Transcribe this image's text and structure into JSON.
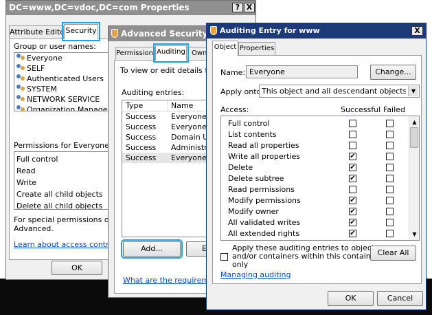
{
  "main_dialog": {
    "title": "DC=www,DC=vdoc,DC=com Properties",
    "help_button": "?",
    "close_button": "X",
    "tabs": [
      "Attribute Editor",
      "Security"
    ],
    "group_label": "Group or user names:",
    "users": [
      "Everyone",
      "SELF",
      "Authenticated Users",
      "SYSTEM",
      "NETWORK SERVICE",
      "Organization Manageme"
    ],
    "permissions_label": "Permissions for Everyone",
    "permissions": [
      "Full control",
      "Read",
      "Write",
      "Create all child objects",
      "Delete all child objects"
    ],
    "special_text": "For special permissions or ad\nAdvanced.",
    "learn_link": "Learn about access control a",
    "ok_label": "OK"
  },
  "advanced_dialog": {
    "title": "Advanced Security Setti",
    "tabs": [
      "Permissions",
      "Auditing",
      "Owne"
    ],
    "view_text": "To view or edit details for an",
    "entries_label": "Auditing entries:",
    "columns": [
      "Type",
      "Name"
    ],
    "rows": [
      [
        "Success",
        "Everyone"
      ],
      [
        "Success",
        "Everyone"
      ],
      [
        "Success",
        "Domain Us"
      ],
      [
        "Success",
        "Administrat"
      ],
      [
        "Success",
        "Everyone"
      ]
    ],
    "add_label": "Add...",
    "edit_label": "E",
    "requirements_link": "What are the requirements fo"
  },
  "auditing_dialog": {
    "title": "Auditing Entry for www",
    "close_button": "X",
    "tabs": [
      "Object",
      "Properties"
    ],
    "name_label": "Name:",
    "name_value": "Everyone",
    "change_label": "Change...",
    "apply_label": "Apply onto:",
    "apply_value": "This object and all descendant objects",
    "access_label": "Access:",
    "successful_label": "Successful",
    "failed_label": "Failed",
    "access_items": [
      {
        "label": "Full control",
        "successful": false,
        "failed": false
      },
      {
        "label": "List contents",
        "successful": false,
        "failed": false
      },
      {
        "label": "Read all properties",
        "successful": false,
        "failed": false
      },
      {
        "label": "Write all properties",
        "successful": true,
        "failed": false
      },
      {
        "label": "Delete",
        "successful": true,
        "failed": false
      },
      {
        "label": "Delete subtree",
        "successful": true,
        "failed": false
      },
      {
        "label": "Read permissions",
        "successful": false,
        "failed": false
      },
      {
        "label": "Modify permissions",
        "successful": true,
        "failed": false
      },
      {
        "label": "Modify owner",
        "successful": true,
        "failed": false
      },
      {
        "label": "All validated writes",
        "successful": true,
        "failed": false
      },
      {
        "label": "All extended rights",
        "successful": true,
        "failed": false
      }
    ],
    "apply_check_text": "Apply these auditing entries to objects\nand/or containers within this container\nonly",
    "clear_all_label": "Clear All",
    "managing_link": "Managing auditing",
    "ok_label": "OK",
    "cancel_label": "Cancel"
  },
  "colors": {
    "desktop": "#000000",
    "title_gray": "#8f8f8f",
    "title_blue": "#1c3a7a",
    "highlight": "#1ea0e6",
    "link": "#0046d5"
  }
}
